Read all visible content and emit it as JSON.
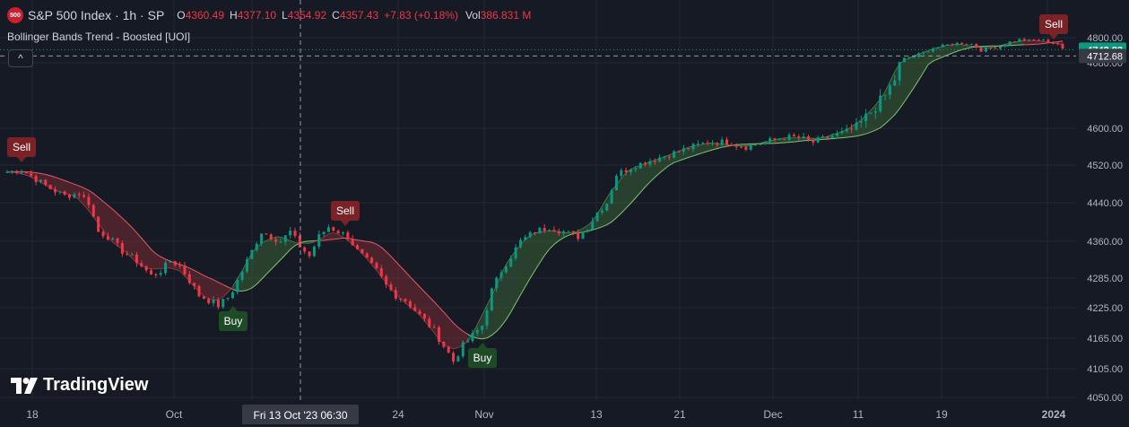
{
  "header": {
    "badge": "500",
    "title": "S&P 500 Index · 1h · SP",
    "ohlc": [
      {
        "label": "O",
        "value": "4360.49"
      },
      {
        "label": "H",
        "value": "4377.10"
      },
      {
        "label": "L",
        "value": "4354.92"
      },
      {
        "label": "C",
        "value": "4357.43"
      }
    ],
    "change": "+7.83 (+0.18%)",
    "vol_label": "Vol",
    "vol_value": "386.831 M"
  },
  "indicator": {
    "name": "Bollinger Bands Trend - Boosted [UOI]",
    "collapse_glyph": "^"
  },
  "branding": {
    "logo_text": "TradingView"
  },
  "colors": {
    "background": "#161a25",
    "grid": "#242832",
    "bull": "#089981",
    "bear": "#f23645",
    "band_bull": "#3e6e38",
    "band_bear": "#8a2f36",
    "axis_text": "#b2b5be"
  },
  "price_axis": {
    "ticks": [
      "4800.00",
      "4680.00",
      "4600.00",
      "4520.00",
      "4440.00",
      "4360.00",
      "4285.00",
      "4225.00",
      "4165.00",
      "4105.00",
      "4050.00"
    ],
    "last_price_tag": "4742.82",
    "crosshair_price_tag": "4712.68"
  },
  "time_axis": {
    "ticks": [
      "18",
      "Oct",
      "24",
      "Nov",
      "13",
      "21",
      "Dec",
      "11",
      "19",
      "2024"
    ],
    "crosshair_label": "Fri 13 Oct '23   06:30"
  },
  "signals": [
    {
      "type": "sell",
      "label": "Sell"
    },
    {
      "type": "buy",
      "label": "Buy"
    },
    {
      "type": "sell",
      "label": "Sell"
    },
    {
      "type": "buy",
      "label": "Buy"
    },
    {
      "type": "sell",
      "label": "Sell"
    }
  ],
  "chart_data": {
    "type": "candlestick",
    "title": "S&P 500 Index · 1h · SP",
    "x_ticks": [
      "18",
      "Oct",
      "24",
      "Nov",
      "13",
      "21",
      "Dec",
      "11",
      "19",
      "2024"
    ],
    "y_ticks": [
      4050,
      4105,
      4165,
      4225,
      4285,
      4360,
      4440,
      4520,
      4600,
      4680,
      4800
    ],
    "ylim": [
      4045,
      4830
    ],
    "price_path": [
      [
        0,
        4505
      ],
      [
        3,
        4510
      ],
      [
        6,
        4490
      ],
      [
        9,
        4470
      ],
      [
        12,
        4455
      ],
      [
        15,
        4460
      ],
      [
        17,
        4440
      ],
      [
        19,
        4380
      ],
      [
        21,
        4370
      ],
      [
        24,
        4340
      ],
      [
        27,
        4320
      ],
      [
        30,
        4290
      ],
      [
        32,
        4300
      ],
      [
        34,
        4320
      ],
      [
        36,
        4310
      ],
      [
        38,
        4280
      ],
      [
        40,
        4250
      ],
      [
        42,
        4240
      ],
      [
        44,
        4230
      ],
      [
        46,
        4245
      ],
      [
        47,
        4260
      ],
      [
        49,
        4300
      ],
      [
        51,
        4340
      ],
      [
        53,
        4380
      ],
      [
        55,
        4370
      ],
      [
        57,
        4360
      ],
      [
        59,
        4380
      ],
      [
        61,
        4350
      ],
      [
        63,
        4330
      ],
      [
        65,
        4370
      ],
      [
        67,
        4390
      ],
      [
        69,
        4380
      ],
      [
        71,
        4370
      ],
      [
        73,
        4340
      ],
      [
        75,
        4320
      ],
      [
        77,
        4300
      ],
      [
        79,
        4270
      ],
      [
        81,
        4250
      ],
      [
        83,
        4240
      ],
      [
        85,
        4220
      ],
      [
        87,
        4200
      ],
      [
        89,
        4180
      ],
      [
        91,
        4150
      ],
      [
        93,
        4120
      ],
      [
        95,
        4150
      ],
      [
        97,
        4170
      ],
      [
        99,
        4190
      ],
      [
        101,
        4260
      ],
      [
        103,
        4300
      ],
      [
        105,
        4330
      ],
      [
        107,
        4360
      ],
      [
        110,
        4380
      ],
      [
        113,
        4390
      ],
      [
        116,
        4380
      ],
      [
        119,
        4370
      ],
      [
        121,
        4390
      ],
      [
        123,
        4420
      ],
      [
        125,
        4440
      ],
      [
        127,
        4500
      ],
      [
        129,
        4510
      ],
      [
        131,
        4520
      ],
      [
        134,
        4530
      ],
      [
        137,
        4540
      ],
      [
        140,
        4550
      ],
      [
        143,
        4560
      ],
      [
        146,
        4570
      ],
      [
        150,
        4570
      ],
      [
        154,
        4560
      ],
      [
        158,
        4570
      ],
      [
        162,
        4580
      ],
      [
        165,
        4580
      ],
      [
        168,
        4570
      ],
      [
        171,
        4580
      ],
      [
        174,
        4590
      ],
      [
        177,
        4600
      ],
      [
        180,
        4620
      ],
      [
        183,
        4640
      ],
      [
        185,
        4660
      ],
      [
        187,
        4700
      ],
      [
        189,
        4710
      ],
      [
        191,
        4730
      ],
      [
        193,
        4750
      ],
      [
        195,
        4760
      ],
      [
        197,
        4770
      ],
      [
        199,
        4775
      ],
      [
        201,
        4770
      ],
      [
        203,
        4740
      ],
      [
        205,
        4750
      ],
      [
        207,
        4760
      ],
      [
        209,
        4780
      ],
      [
        211,
        4790
      ],
      [
        213,
        4785
      ],
      [
        215,
        4790
      ],
      [
        217,
        4780
      ],
      [
        219,
        4770
      ],
      [
        220,
        4742
      ]
    ],
    "band_segments": [
      {
        "trend": "bear",
        "from": 0,
        "to": 47
      },
      {
        "trend": "bull",
        "from": 47,
        "to": 64
      },
      {
        "trend": "bear",
        "from": 64,
        "to": 96
      },
      {
        "trend": "bull",
        "from": 96,
        "to": 212
      },
      {
        "trend": "bear",
        "from": 212,
        "to": 220
      }
    ],
    "last_price": 4742.82,
    "crosshair_price": 4712.68
  }
}
